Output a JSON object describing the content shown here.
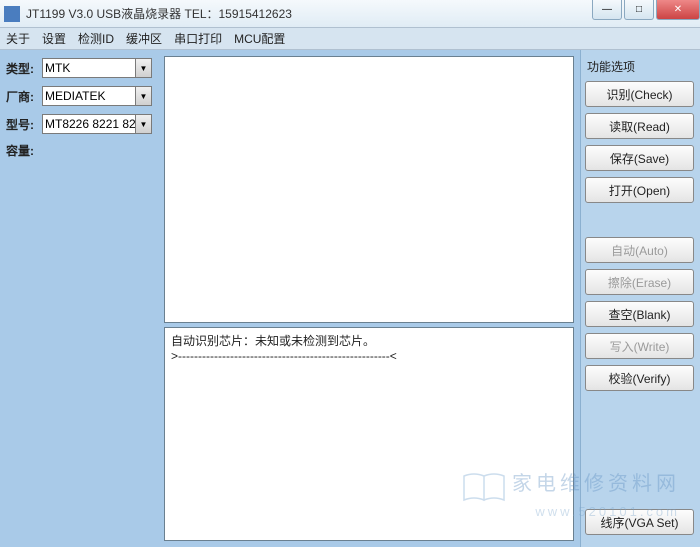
{
  "title": "JT1199 V3.0 USB液晶烧录器   TEL：15915412623",
  "menu": {
    "about": "关于",
    "settings": "设置",
    "detect_id": "检测ID",
    "buffer": "缓冲区",
    "serial_print": "串口打印",
    "mcu_config": "MCU配置"
  },
  "fields": {
    "type_label": "类型:",
    "type_value": "MTK",
    "vendor_label": "厂商:",
    "vendor_value": "MEDIATEK",
    "model_label": "型号:",
    "model_value": "MT8226 8221 82",
    "capacity_label": "容量:",
    "capacity_value": ""
  },
  "log": {
    "line1": "自动识别芯片：未知或未检测到芯片。",
    "line2": ">-----------------------------------------------------<"
  },
  "rightpanel": {
    "section_title": "功能选项",
    "check": "识别(Check)",
    "read": "读取(Read)",
    "save": "保存(Save)",
    "open": "打开(Open)",
    "auto": "自动(Auto)",
    "erase": "擦除(Erase)",
    "blank": "查空(Blank)",
    "write": "写入(Write)",
    "verify": "校验(Verify)",
    "vgaset": "线序(VGA Set)"
  },
  "winctrl": {
    "min": "—",
    "max": "□",
    "close": "✕"
  },
  "watermark": {
    "line1": "家电维修资料网",
    "line2": "www.520101.com"
  }
}
